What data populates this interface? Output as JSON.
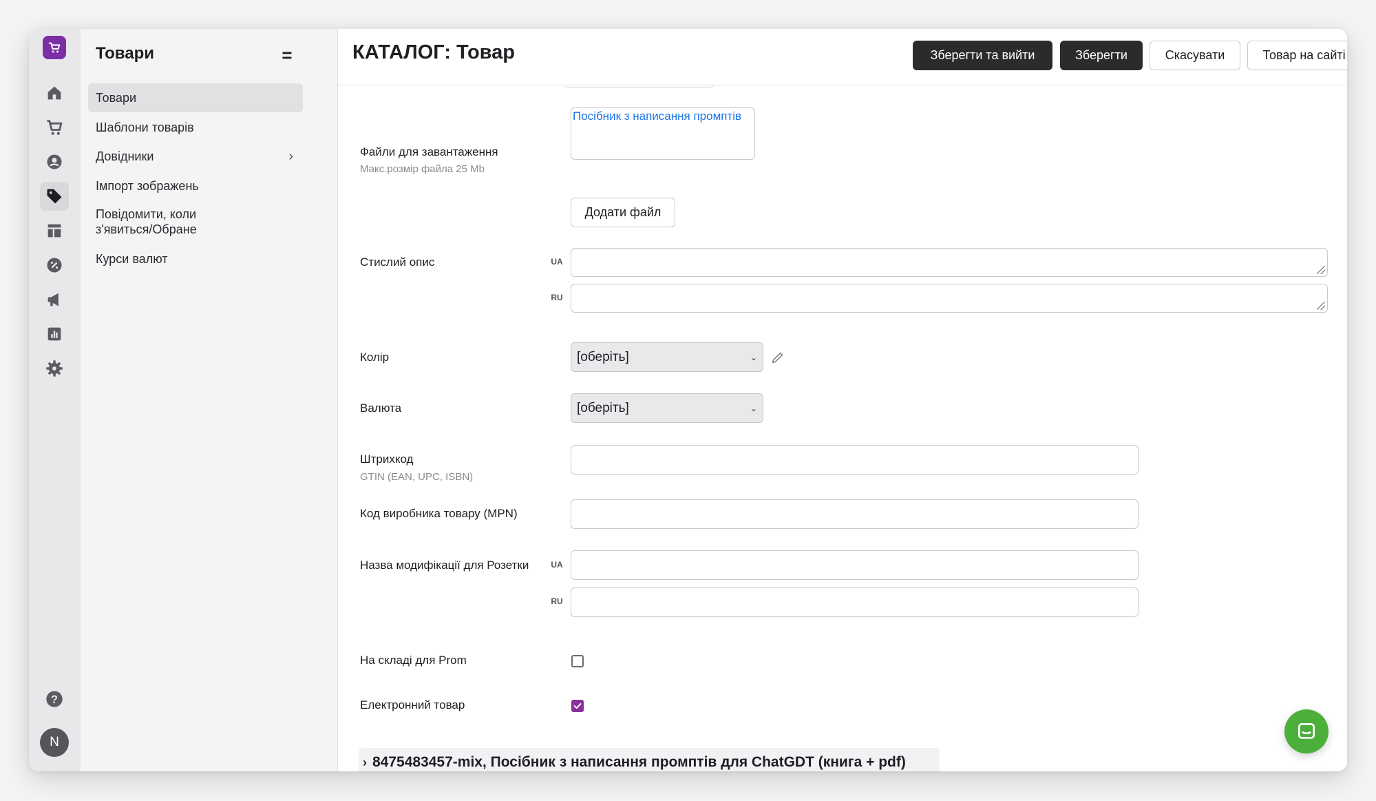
{
  "sidebar": {
    "title": "Товари",
    "toggle": "=",
    "items": [
      {
        "label": "Товари"
      },
      {
        "label": "Шаблони товарів"
      },
      {
        "label": "Довідники"
      },
      {
        "label": "Імпорт зображень"
      },
      {
        "label": "Повідомити, коли з'явиться/Обране"
      },
      {
        "label": "Курси валют"
      }
    ]
  },
  "rail": {
    "avatar": "N"
  },
  "header": {
    "title": "КАТАЛОГ: Товар",
    "save_exit": "Зберегти та вийти",
    "save": "Зберегти",
    "cancel": "Скасувати",
    "on_site": "Товар на сайті"
  },
  "form": {
    "files_label": "Файли для завантаження",
    "files_hint": "Макс.розмір файла 25 Mb",
    "file_name": "Посібник з написання промптів",
    "add_file": "Додати файл",
    "short_desc_label": "Стислий опис",
    "lang_ua": "UA",
    "lang_ru": "RU",
    "color_label": "Колір",
    "color_value": "[оберіть]",
    "currency_label": "Валюта",
    "currency_value": "[оберіть]",
    "barcode_label": "Штрихкод",
    "barcode_hint": "GTIN (EAN, UPC, ISBN)",
    "mpn_label": "Код виробника товару (MPN)",
    "rozetka_label": "Назва модифікації для Розетки",
    "prom_label": "На складі для Prom",
    "prom_checked": false,
    "electronic_label": "Електронний товар",
    "electronic_checked": true
  },
  "variant": {
    "title": "8475483457-mix, Посібник з написання промптів для ChatGDT (книга + pdf)"
  },
  "colors": {
    "brand": "#7b2ea6",
    "checkbox": "#8a2f9c",
    "chat": "#4caf3a",
    "primary_btn": "#2b2b2e"
  }
}
